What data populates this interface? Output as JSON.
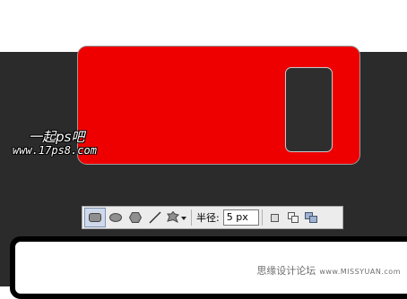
{
  "logo": {
    "text_cn": "一起ps吧",
    "text_url": "www.17ps8.com"
  },
  "toolbar": {
    "tools": [
      "rounded-rectangle-tool",
      "ellipse-tool",
      "polygon-tool",
      "line-tool",
      "custom-shape-tool"
    ],
    "radius_label": "半径:",
    "radius_value": "5 px",
    "path_modes": [
      "add-to-shape-area",
      "subtract-from-shape-area",
      "intersect-shape-areas"
    ]
  },
  "footer": {
    "site_cn": "思缘设计论坛",
    "site_url": "www.MISSYUAN.com"
  },
  "colors": {
    "canvas": "#2b2b2b",
    "shape_fill": "#ee0000",
    "toolbar_bg": "#ececec"
  }
}
